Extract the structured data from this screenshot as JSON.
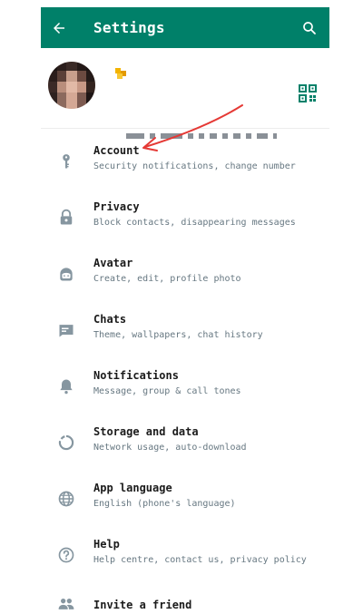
{
  "colors": {
    "brand": "#008069",
    "icon": "#8696a0",
    "subtext": "#667781",
    "annotation_arrow": "#e53935"
  },
  "appbar": {
    "title": "Settings",
    "back_icon": "arrow-left-icon",
    "search_icon": "search-icon"
  },
  "profile": {
    "avatar_icon": "profile-photo",
    "qr_icon": "qr-code-icon"
  },
  "settings": [
    {
      "label": "Account",
      "sub": "Security notifications, change number",
      "icon": "key-icon"
    },
    {
      "label": "Privacy",
      "sub": "Block contacts, disappearing messages",
      "icon": "lock-icon"
    },
    {
      "label": "Avatar",
      "sub": "Create, edit, profile photo",
      "icon": "avatar-face-icon"
    },
    {
      "label": "Chats",
      "sub": "Theme, wallpapers, chat history",
      "icon": "chat-icon"
    },
    {
      "label": "Notifications",
      "sub": "Message, group & call tones",
      "icon": "bell-icon"
    },
    {
      "label": "Storage and data",
      "sub": "Network usage, auto-download",
      "icon": "storage-circle-icon"
    },
    {
      "label": "App language",
      "sub": "English (phone's language)",
      "icon": "globe-icon"
    },
    {
      "label": "Help",
      "sub": "Help centre, contact us, privacy policy",
      "icon": "help-icon"
    },
    {
      "label": "Invite a friend",
      "sub": "",
      "icon": "people-icon"
    }
  ]
}
